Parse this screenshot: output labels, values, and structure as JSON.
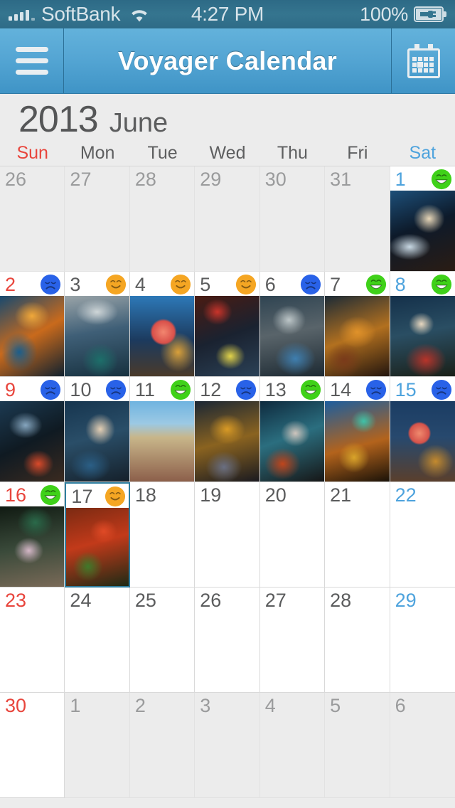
{
  "statusbar": {
    "carrier": "SoftBank",
    "time": "4:27 PM",
    "battery": "100%",
    "signal_icon": "signal-bars-icon",
    "wifi_icon": "wifi-icon",
    "battery_icon": "battery-charging-icon"
  },
  "navbar": {
    "menu_icon": "hamburger-menu-icon",
    "title": "Voyager Calendar",
    "calendar_icon": "calendar-icon"
  },
  "month_header": {
    "year": "2013",
    "month": "June"
  },
  "weekdays": [
    {
      "label": "Sun",
      "kind": "sun"
    },
    {
      "label": "Mon",
      "kind": "weekday"
    },
    {
      "label": "Tue",
      "kind": "weekday"
    },
    {
      "label": "Wed",
      "kind": "weekday"
    },
    {
      "label": "Thu",
      "kind": "weekday"
    },
    {
      "label": "Fri",
      "kind": "weekday"
    },
    {
      "label": "Sat",
      "kind": "sat"
    }
  ],
  "colors": {
    "sunday": "#e8453c",
    "saturday": "#4ea3dd",
    "weekday": "#5b5c5d",
    "out_of_month": "#9a9b9c",
    "navbar": "#55a6d4",
    "statusbar": "#35758f",
    "today_border": "#2f7e9f",
    "mood_happy": "#3fd119",
    "mood_ok": "#f5a623",
    "mood_sad": "#2962e8",
    "grid_line": "#d9d9d9",
    "page_bg": "#ececec"
  },
  "mood_legend": {
    "happy": "green-laughing-face-icon",
    "ok": "orange-smiling-face-icon",
    "sad": "blue-sad-face-icon"
  },
  "days": [
    {
      "num": "26",
      "kind": "sun",
      "out": true,
      "mood": null,
      "thumb": null,
      "today": false
    },
    {
      "num": "27",
      "kind": "weekday",
      "out": true,
      "mood": null,
      "thumb": null,
      "today": false
    },
    {
      "num": "28",
      "kind": "weekday",
      "out": true,
      "mood": null,
      "thumb": null,
      "today": false
    },
    {
      "num": "29",
      "kind": "weekday",
      "out": true,
      "mood": null,
      "thumb": null,
      "today": false
    },
    {
      "num": "30",
      "kind": "weekday",
      "out": true,
      "mood": null,
      "thumb": null,
      "today": false
    },
    {
      "num": "31",
      "kind": "weekday",
      "out": true,
      "mood": null,
      "thumb": null,
      "today": false
    },
    {
      "num": "1",
      "kind": "sat",
      "out": false,
      "mood": "happy",
      "thumb": "t-a",
      "today": false
    },
    {
      "num": "2",
      "kind": "sun",
      "out": false,
      "mood": "sad",
      "thumb": "t-b",
      "today": false
    },
    {
      "num": "3",
      "kind": "weekday",
      "out": false,
      "mood": "ok",
      "thumb": "t-c",
      "today": false
    },
    {
      "num": "4",
      "kind": "weekday",
      "out": false,
      "mood": "ok",
      "thumb": "t-d",
      "today": false
    },
    {
      "num": "5",
      "kind": "weekday",
      "out": false,
      "mood": "ok",
      "thumb": "t-e",
      "today": false
    },
    {
      "num": "6",
      "kind": "weekday",
      "out": false,
      "mood": "sad",
      "thumb": "t-f",
      "today": false
    },
    {
      "num": "7",
      "kind": "weekday",
      "out": false,
      "mood": "happy",
      "thumb": "t-g",
      "today": false
    },
    {
      "num": "8",
      "kind": "sat",
      "out": false,
      "mood": "happy",
      "thumb": "t-h",
      "today": false
    },
    {
      "num": "9",
      "kind": "sun",
      "out": false,
      "mood": "sad",
      "thumb": "t-i",
      "today": false
    },
    {
      "num": "10",
      "kind": "weekday",
      "out": false,
      "mood": "sad",
      "thumb": "t-j",
      "today": false
    },
    {
      "num": "11",
      "kind": "weekday",
      "out": false,
      "mood": "happy",
      "thumb": "t-k",
      "today": false
    },
    {
      "num": "12",
      "kind": "weekday",
      "out": false,
      "mood": "sad",
      "thumb": "t-l",
      "today": false
    },
    {
      "num": "13",
      "kind": "weekday",
      "out": false,
      "mood": "happy",
      "thumb": "t-m",
      "today": false
    },
    {
      "num": "14",
      "kind": "weekday",
      "out": false,
      "mood": "sad",
      "thumb": "t-n",
      "today": false
    },
    {
      "num": "15",
      "kind": "sat",
      "out": false,
      "mood": "sad",
      "thumb": "t-o",
      "today": false
    },
    {
      "num": "16",
      "kind": "sun",
      "out": false,
      "mood": "happy",
      "thumb": "t-p",
      "today": false
    },
    {
      "num": "17",
      "kind": "weekday",
      "out": false,
      "mood": "ok",
      "thumb": "t-q",
      "today": true
    },
    {
      "num": "18",
      "kind": "weekday",
      "out": false,
      "mood": null,
      "thumb": null,
      "today": false
    },
    {
      "num": "19",
      "kind": "weekday",
      "out": false,
      "mood": null,
      "thumb": null,
      "today": false
    },
    {
      "num": "20",
      "kind": "weekday",
      "out": false,
      "mood": null,
      "thumb": null,
      "today": false
    },
    {
      "num": "21",
      "kind": "weekday",
      "out": false,
      "mood": null,
      "thumb": null,
      "today": false
    },
    {
      "num": "22",
      "kind": "sat",
      "out": false,
      "mood": null,
      "thumb": null,
      "today": false
    },
    {
      "num": "23",
      "kind": "sun",
      "out": false,
      "mood": null,
      "thumb": null,
      "today": false
    },
    {
      "num": "24",
      "kind": "weekday",
      "out": false,
      "mood": null,
      "thumb": null,
      "today": false
    },
    {
      "num": "25",
      "kind": "weekday",
      "out": false,
      "mood": null,
      "thumb": null,
      "today": false
    },
    {
      "num": "26",
      "kind": "weekday",
      "out": false,
      "mood": null,
      "thumb": null,
      "today": false
    },
    {
      "num": "27",
      "kind": "weekday",
      "out": false,
      "mood": null,
      "thumb": null,
      "today": false
    },
    {
      "num": "28",
      "kind": "weekday",
      "out": false,
      "mood": null,
      "thumb": null,
      "today": false
    },
    {
      "num": "29",
      "kind": "sat",
      "out": false,
      "mood": null,
      "thumb": null,
      "today": false
    },
    {
      "num": "30",
      "kind": "sun",
      "out": false,
      "mood": null,
      "thumb": null,
      "today": false
    },
    {
      "num": "1",
      "kind": "weekday",
      "out": true,
      "mood": null,
      "thumb": null,
      "today": false
    },
    {
      "num": "2",
      "kind": "weekday",
      "out": true,
      "mood": null,
      "thumb": null,
      "today": false
    },
    {
      "num": "3",
      "kind": "weekday",
      "out": true,
      "mood": null,
      "thumb": null,
      "today": false
    },
    {
      "num": "4",
      "kind": "weekday",
      "out": true,
      "mood": null,
      "thumb": null,
      "today": false
    },
    {
      "num": "5",
      "kind": "weekday",
      "out": true,
      "mood": null,
      "thumb": null,
      "today": false
    },
    {
      "num": "6",
      "kind": "sat",
      "out": true,
      "mood": null,
      "thumb": null,
      "today": false
    }
  ]
}
